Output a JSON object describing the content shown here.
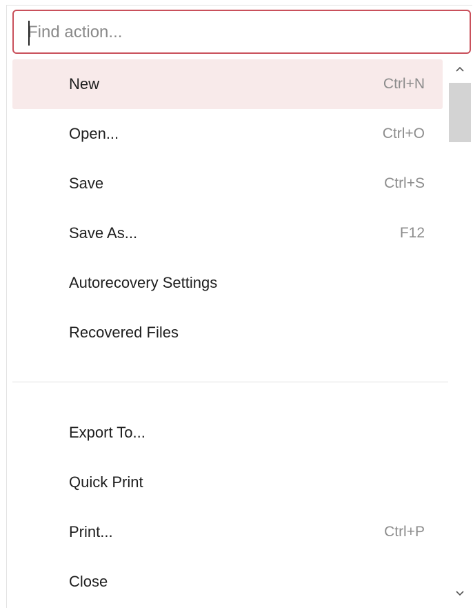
{
  "search": {
    "placeholder": "Find action...",
    "value": ""
  },
  "menu": {
    "items": [
      {
        "label": "New",
        "shortcut": "Ctrl+N",
        "selected": true
      },
      {
        "label": "Open...",
        "shortcut": "Ctrl+O"
      },
      {
        "label": "Save",
        "shortcut": "Ctrl+S"
      },
      {
        "label": "Save As...",
        "shortcut": "F12"
      },
      {
        "label": "Autorecovery Settings",
        "shortcut": ""
      },
      {
        "label": "Recovered Files",
        "shortcut": ""
      },
      {
        "label": "Export To...",
        "shortcut": ""
      },
      {
        "label": "Quick Print",
        "shortcut": ""
      },
      {
        "label": "Print...",
        "shortcut": "Ctrl+P"
      },
      {
        "label": "Close",
        "shortcut": ""
      }
    ]
  },
  "icons": {
    "scroll_up": "chevron-up-icon",
    "scroll_down": "chevron-down-icon"
  },
  "colors": {
    "accent_border": "#c9505b",
    "selected_background": "#f8eaea"
  }
}
